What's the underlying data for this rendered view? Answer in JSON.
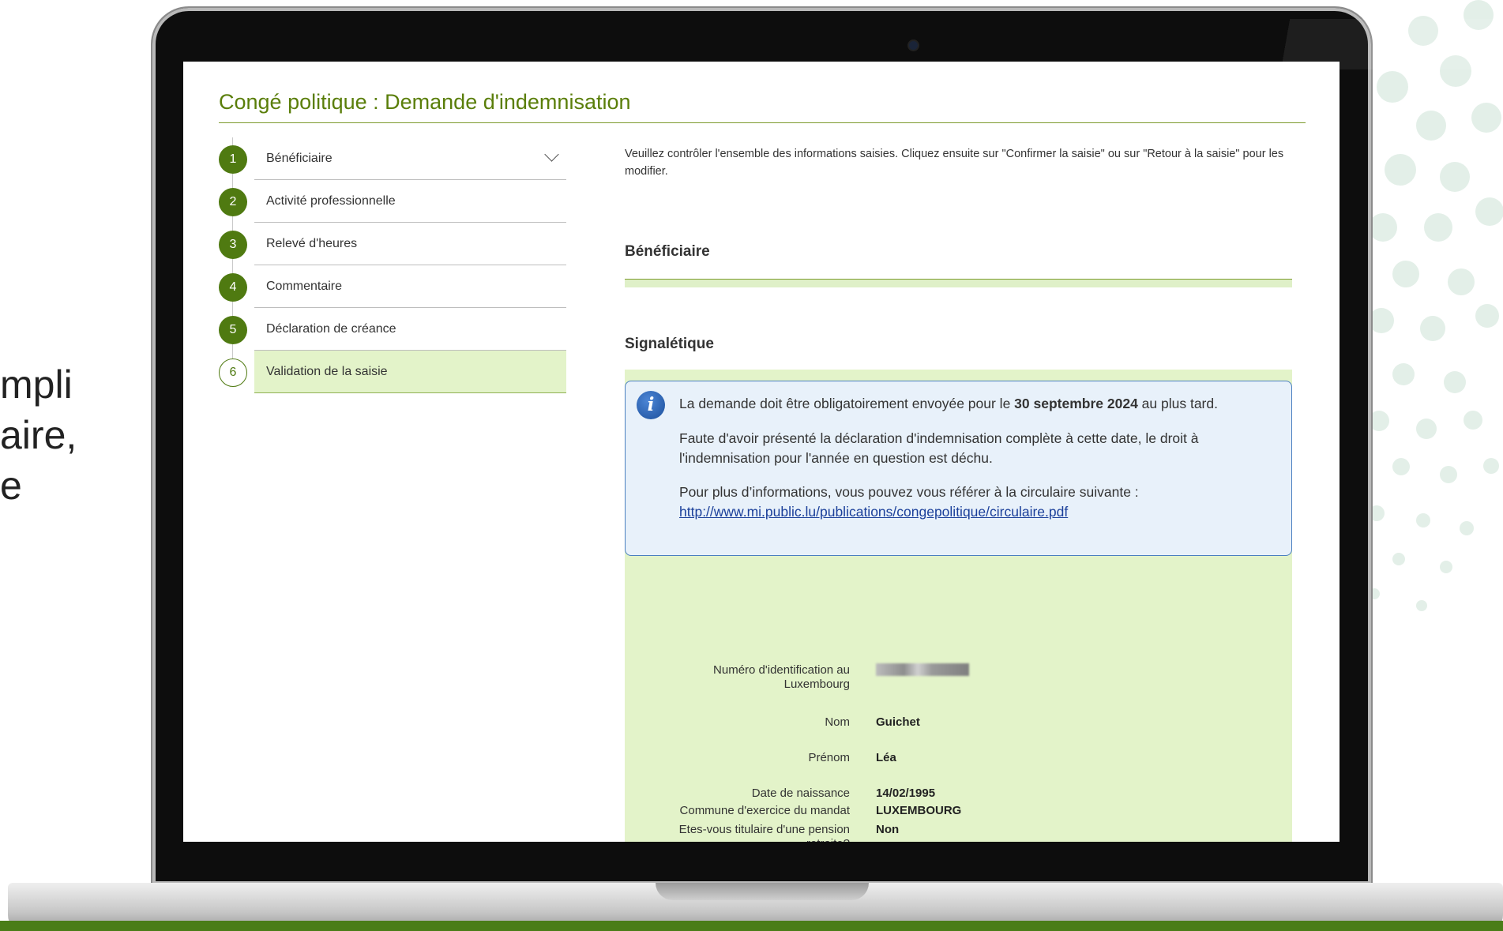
{
  "side_text": [
    "mpli",
    "aire,",
    "e"
  ],
  "app": {
    "title": "Congé politique : Demande d'indemnisation"
  },
  "steps": [
    {
      "number": "1",
      "label": "Bénéficiaire"
    },
    {
      "number": "2",
      "label": "Activité professionnelle"
    },
    {
      "number": "3",
      "label": "Relevé d'heures"
    },
    {
      "number": "4",
      "label": "Commentaire"
    },
    {
      "number": "5",
      "label": "Déclaration de créance"
    },
    {
      "number": "6",
      "label": "Validation de la saisie"
    }
  ],
  "intro": "Veuillez contrôler l'ensemble des informations saisies. Cliquez ensuite sur \"Confirmer la saisie\" ou sur \"Retour à la saisie\" pour les modifier.",
  "sections": {
    "beneficiaire": "Bénéficiaire",
    "signaletique": "Signalétique"
  },
  "info": {
    "line1_prefix": "La demande doit être obligatoirement envoyée pour le ",
    "line1_bold": "30 septembre 2024",
    "line1_suffix": " au plus tard.",
    "line2": "Faute d'avoir présenté la déclaration d'indemnisation complète à cette date, le droit à l'indemnisation pour l'année en question est déchu.",
    "line3_prefix": "Pour plus d’informations, vous pouvez vous référer à la circulaire suivante : ",
    "link": "http://www.mi.public.lu/publications/congepolitique/circulaire.pdf"
  },
  "fields": [
    {
      "label": "Numéro d'identification au Luxembourg",
      "value": ""
    },
    {
      "label": "Nom",
      "value": "Guichet"
    },
    {
      "label": "Prénom",
      "value": "Léa"
    },
    {
      "label": "Date de naissance",
      "value": "14/02/1995"
    },
    {
      "label": "Etes-vous titulaire d'une pension retraite?",
      "value": "Non"
    },
    {
      "label": "Commune d'exercice du mandat",
      "value": "LUXEMBOURG"
    }
  ],
  "colors": {
    "brand_green": "#5a7e0a",
    "highlight_green": "#e3f3c9",
    "info_blue": "#e8f1fa"
  }
}
